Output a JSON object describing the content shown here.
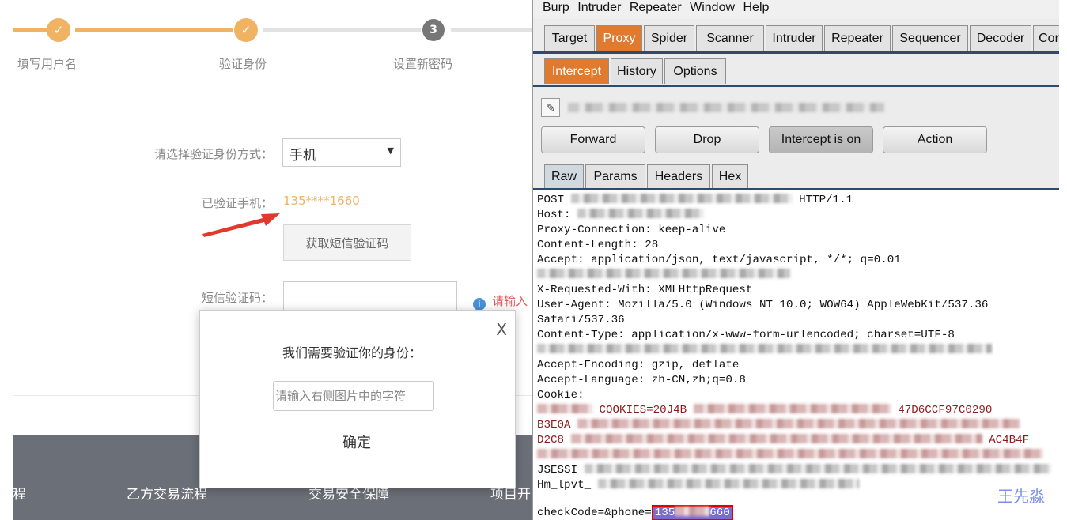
{
  "steps": [
    {
      "label": "填写用户名",
      "icon": "check-icon",
      "state": "done"
    },
    {
      "label": "验证身份",
      "icon": "check-icon",
      "state": "done"
    },
    {
      "label": "设置新密码",
      "number": "3",
      "state": "current"
    }
  ],
  "form": {
    "method_label": "请选择验证身份方式：",
    "method_value": "手机",
    "verified_label": "已验证手机：",
    "verified_value": "135****1660",
    "sms_button": "获取短信验证码",
    "sms_label": "短信验证码：",
    "sms_hint": "请输入"
  },
  "footer": {
    "links": [
      "程",
      "乙方交易流程",
      "交易安全保障",
      "项目开"
    ]
  },
  "modal": {
    "close": "X",
    "title": "我们需要验证你的身份：",
    "placeholder": "请输入右侧图片中的字符",
    "confirm": "确定"
  },
  "burp": {
    "menu": [
      "Burp",
      "Intruder",
      "Repeater",
      "Window",
      "Help"
    ],
    "tabs": [
      "Target",
      "Proxy",
      "Spider",
      "Scanner",
      "Intruder",
      "Repeater",
      "Sequencer",
      "Decoder",
      "Cor"
    ],
    "active_tab": "Proxy",
    "proxy_tabs": [
      "Intercept",
      "History",
      "Options"
    ],
    "active_proxy_tab": "Intercept",
    "buttons": {
      "forward": "Forward",
      "drop": "Drop",
      "intercept": "Intercept is on",
      "action": "Action"
    },
    "view_tabs": [
      "Raw",
      "Params",
      "Headers",
      "Hex"
    ],
    "active_view_tab": "Raw",
    "request": {
      "post_start": "POST",
      "post_end": "HTTP/1.1",
      "host": "Host:",
      "proxy_connection": "Proxy-Connection: keep-alive",
      "content_length": "Content-Length: 28",
      "accept": "Accept: application/json, text/javascript, */*; q=0.01",
      "x_requested_with": "X-Requested-With: XMLHttpRequest",
      "user_agent": "User-Agent: Mozilla/5.0 (Windows NT 10.0; WOW64) AppleWebKit/537.36",
      "safari": "Safari/537.36",
      "content_type": "Content-Type: application/x-www-form-urlencoded; charset=UTF-8",
      "accept_encoding": "Accept-Encoding: gzip, deflate",
      "accept_language": "Accept-Language: zh-CN,zh;q=0.8",
      "cookie": "Cookie:",
      "cookie_line1_mid": "COOKIES=20J4B",
      "cookie_line1_end": "47D6CCF97C0290",
      "cookie_line2": "B3E0A",
      "cookie_line3": "D2C8",
      "cookie_line3_end": "AC4B4F",
      "jsessi": "JSESSI",
      "hm_lpvt": "Hm_lpvt_",
      "body_prefix": "checkCode=&phone=",
      "phone_start": "135",
      "phone_end": "660"
    },
    "watermark": "王先淼"
  }
}
